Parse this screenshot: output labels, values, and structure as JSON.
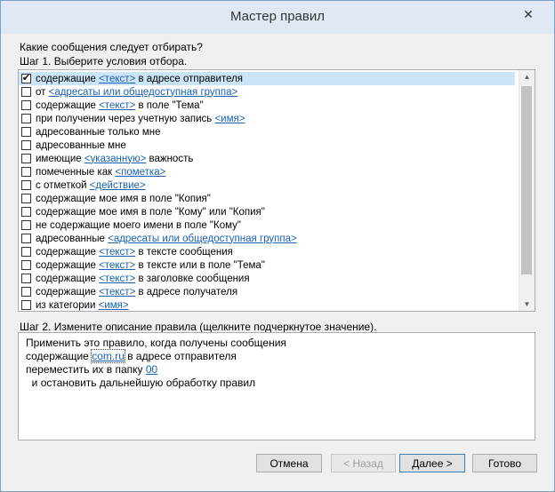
{
  "window": {
    "title": "Мастер правил",
    "close_glyph": "✕"
  },
  "prompt": {
    "question": "Какие сообщения следует отбирать?",
    "step1": "Шаг 1. Выберите условия отбора."
  },
  "conditions": [
    {
      "checked": true,
      "pre": "содержащие ",
      "link": "<текст>",
      "post": " в адресе отправителя"
    },
    {
      "checked": false,
      "pre": "от ",
      "link": "<адресаты или общедоступная группа>",
      "post": ""
    },
    {
      "checked": false,
      "pre": "содержащие ",
      "link": "<текст>",
      "post": " в поле \"Тема\""
    },
    {
      "checked": false,
      "pre": "при получении через учетную запись ",
      "link": "<имя>",
      "post": ""
    },
    {
      "checked": false,
      "pre": "адресованные только мне",
      "link": "",
      "post": ""
    },
    {
      "checked": false,
      "pre": "адресованные мне",
      "link": "",
      "post": ""
    },
    {
      "checked": false,
      "pre": "имеющие ",
      "link": "<указанную>",
      "post": " важность"
    },
    {
      "checked": false,
      "pre": "помеченные как ",
      "link": "<пометка>",
      "post": ""
    },
    {
      "checked": false,
      "pre": "с отметкой ",
      "link": "<действие>",
      "post": ""
    },
    {
      "checked": false,
      "pre": "содержащие мое имя в поле \"Копия\"",
      "link": "",
      "post": ""
    },
    {
      "checked": false,
      "pre": "содержащие мое имя в поле \"Кому\" или \"Копия\"",
      "link": "",
      "post": ""
    },
    {
      "checked": false,
      "pre": "не содержащие моего имени в поле \"Кому\"",
      "link": "",
      "post": ""
    },
    {
      "checked": false,
      "pre": "адресованные ",
      "link": "<адресаты или общедоступная группа>",
      "post": ""
    },
    {
      "checked": false,
      "pre": "содержащие ",
      "link": "<текст>",
      "post": " в тексте сообщения"
    },
    {
      "checked": false,
      "pre": "содержащие ",
      "link": "<текст>",
      "post": " в тексте или в поле \"Тема\""
    },
    {
      "checked": false,
      "pre": "содержащие ",
      "link": "<текст>",
      "post": " в заголовке сообщения"
    },
    {
      "checked": false,
      "pre": "содержащие ",
      "link": "<текст>",
      "post": " в адресе получателя"
    },
    {
      "checked": false,
      "pre": "из категории ",
      "link": "<имя>",
      "post": ""
    }
  ],
  "scrollbar": {
    "up": "▲",
    "down": "▼"
  },
  "step2": {
    "label": "Шаг 2. Измените описание правила (щелкните подчеркнутое значение).",
    "line1": "Применить это правило, когда получены сообщения",
    "line2_pre": "содержащие ",
    "line2_link": "com.ru",
    "line2_post": " в адресе отправителя",
    "line3_pre": "переместить их в папку ",
    "line3_link": "00",
    "line4": "  и остановить дальнейшую обработку правил"
  },
  "buttons": {
    "cancel": "Отмена",
    "back": "< Назад",
    "next": "Далее >",
    "finish": "Готово"
  }
}
